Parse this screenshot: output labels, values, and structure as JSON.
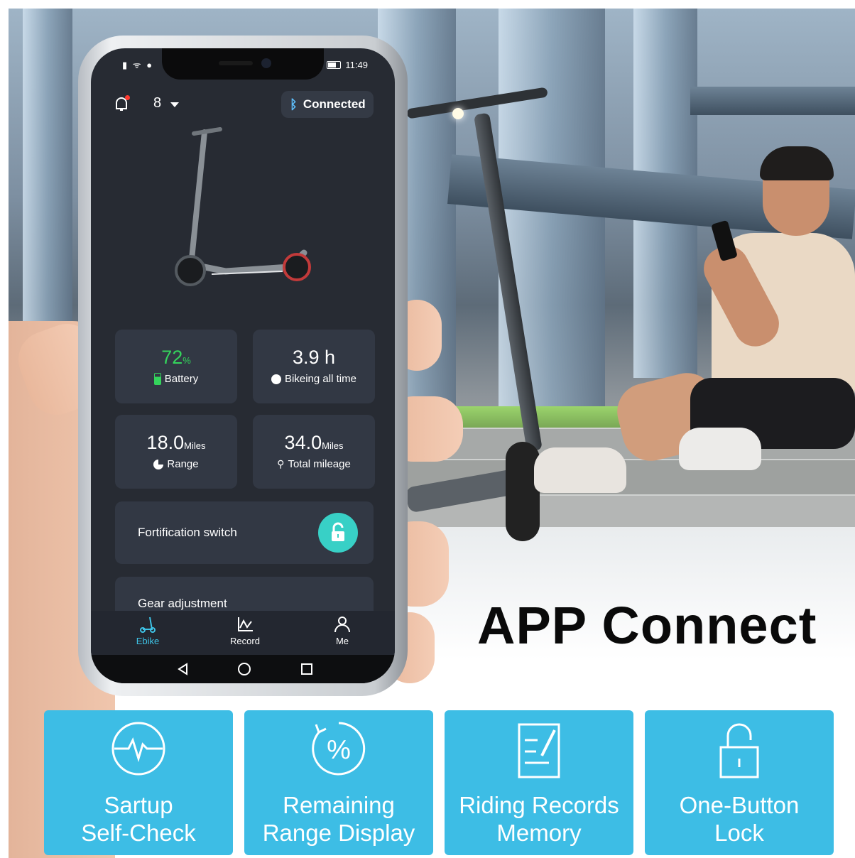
{
  "status_bar": {
    "left_icons": "▮ ᯤ ●",
    "time": "11:49"
  },
  "app": {
    "device_selector": "8",
    "connection_status": "Connected",
    "stats": {
      "battery": {
        "value": "72",
        "unit": "%",
        "label": "Battery"
      },
      "bike_time": {
        "value": "3.9 h",
        "label": "Bikeing all time"
      },
      "range": {
        "value": "18.0",
        "unit": "Miles",
        "label": "Range"
      },
      "total_mileage": {
        "value": "34.0",
        "unit": "Miles",
        "label": "Total mileage"
      }
    },
    "fortification": {
      "label": "Fortification switch",
      "locked": false
    },
    "gear": {
      "label": "Gear adjustment"
    },
    "nav": [
      {
        "label": "Ebike",
        "icon": "scooter-icon",
        "active": true
      },
      {
        "label": "Record",
        "icon": "chart-icon",
        "active": false
      },
      {
        "label": "Me",
        "icon": "person-icon",
        "active": false
      }
    ],
    "colors": {
      "battery_green": "#34d45c",
      "active_tab": "#3ec3e6",
      "lock_button": "#38d0c6"
    }
  },
  "headline": "APP Connect",
  "features": [
    {
      "line1": "Sartup",
      "line2": "Self-Check",
      "icon": "heartbeat-icon"
    },
    {
      "line1": "Remaining",
      "line2": "Range Display",
      "icon": "percent-icon"
    },
    {
      "line1": "Riding Records",
      "line2": "Memory",
      "icon": "notepad-icon"
    },
    {
      "line1": "One-Button",
      "line2": "Lock",
      "icon": "padlock-icon"
    }
  ],
  "tile_color": "#3dbde5"
}
